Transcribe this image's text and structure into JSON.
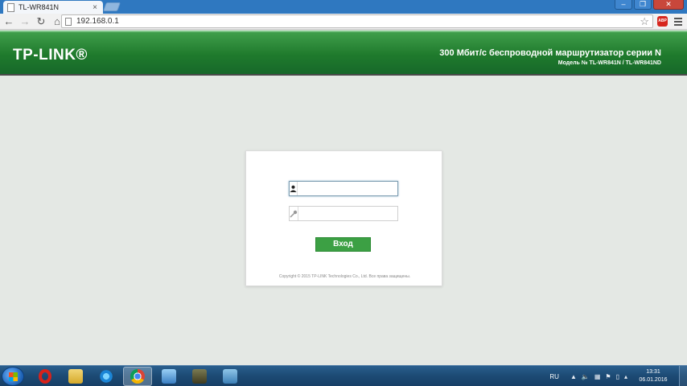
{
  "browser": {
    "tab_title": "TL-WR841N",
    "tab_close": "×",
    "url": "192.168.0.1",
    "window_controls": [
      "–",
      "❐",
      "✕"
    ],
    "adblock_label": "ABP"
  },
  "header": {
    "logo": "TP-LINK®",
    "title": "300 Мбит/с беспроводной маршрутизатор серии N",
    "model": "Модель № TL-WR841N / TL-WR841ND",
    "color_primary": "#1f7a2c"
  },
  "login": {
    "username_value": "",
    "password_value": "",
    "button_label": "Вход",
    "copyright": "Copyright © 2015 TP-LINK Technologies Co., Ltd. Все права защищены."
  },
  "taskbar": {
    "apps": [
      "opera",
      "file-explorer",
      "internet-explorer",
      "chrome",
      "photo-viewer",
      "camtasia",
      "network"
    ],
    "active_app": "chrome",
    "language": "RU",
    "time": "13:31",
    "date": "06.01.2016"
  }
}
